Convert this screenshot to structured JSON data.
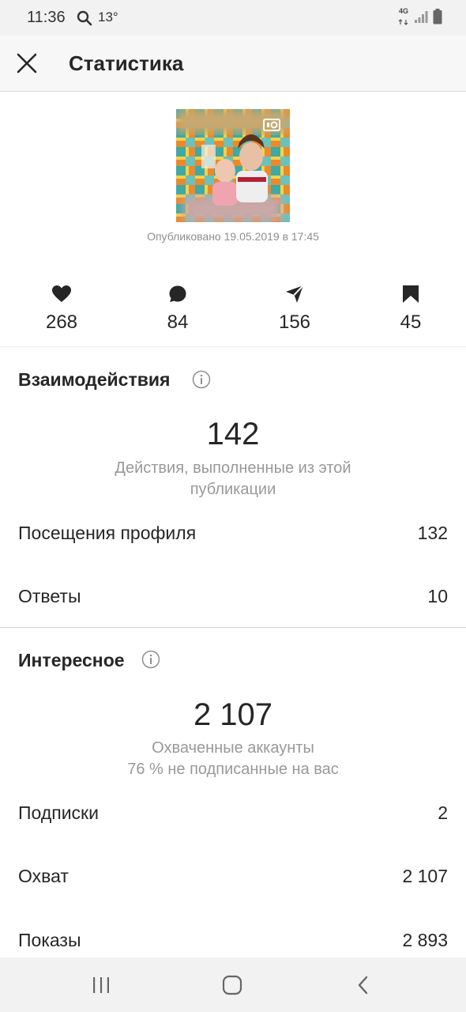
{
  "status_bar": {
    "time": "11:36",
    "temperature": "13°",
    "network": "4G",
    "icons": [
      "search-icon",
      "signal-icon",
      "battery-icon"
    ]
  },
  "header": {
    "title": "Статистика",
    "close_icon": "close-icon"
  },
  "post": {
    "media_icon": "video-icon",
    "published": "Опубликовано 19.05.2019 в 17:45"
  },
  "stats": [
    {
      "icon": "heart-icon",
      "value": "268"
    },
    {
      "icon": "comment-icon",
      "value": "84"
    },
    {
      "icon": "send-icon",
      "value": "156"
    },
    {
      "icon": "bookmark-icon",
      "value": "45"
    }
  ],
  "interactions": {
    "title": "Взаимодействия",
    "total": "142",
    "caption_line1": "Действия, выполненные из этой",
    "caption_line2": "публикации",
    "rows": [
      {
        "label": "Посещения профиля",
        "value": "132"
      },
      {
        "label": "Ответы",
        "value": "10"
      }
    ]
  },
  "discovery": {
    "title": "Интересное",
    "total": "2 107",
    "caption_line1": "Охваченные аккаунты",
    "caption_line2": "76 % не подписанные на вас",
    "rows": [
      {
        "label": "Подписки",
        "value": "2"
      },
      {
        "label": "Охват",
        "value": "2 107"
      },
      {
        "label": "Показы",
        "value": "2 893"
      }
    ]
  },
  "nav": {
    "icons": [
      "recent-apps-icon",
      "home-icon",
      "back-icon"
    ]
  }
}
